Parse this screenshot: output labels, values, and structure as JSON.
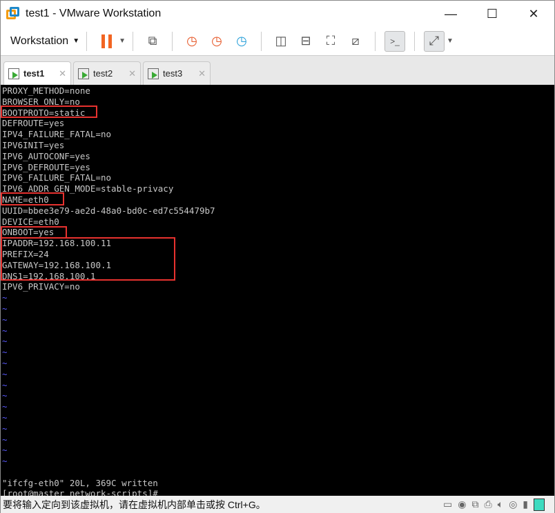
{
  "window": {
    "title": "test1 - VMware Workstation",
    "minimize": "—",
    "maximize": "☐",
    "close": "✕"
  },
  "toolbar": {
    "menu_label": "Workstation",
    "icons": [
      "pause-icon",
      "send-ctrl-alt-del-icon",
      "snapshot-take-icon",
      "snapshot-revert-icon",
      "snapshot-manager-icon",
      "library-view-icon",
      "thumbnail-view-icon",
      "fullscreen-icon",
      "unity-icon",
      "console-view-icon",
      "stretch-icon"
    ]
  },
  "tabs": [
    {
      "label": "test1",
      "active": true
    },
    {
      "label": "test2"
    },
    {
      "label": "test3"
    }
  ],
  "terminal": {
    "lines": [
      "PROXY_METHOD=none",
      "BROWSER_ONLY=no",
      "BOOTPROTO=static",
      "DEFROUTE=yes",
      "IPV4_FAILURE_FATAL=no",
      "IPV6INIT=yes",
      "IPV6_AUTOCONF=yes",
      "IPV6_DEFROUTE=yes",
      "IPV6_FAILURE_FATAL=no",
      "IPV6_ADDR_GEN_MODE=stable-privacy",
      "NAME=eth0",
      "UUID=bbee3e79-ae2d-48a0-bd0c-ed7c554479b7",
      "DEVICE=eth0",
      "ONBOOT=yes",
      "IPADDR=192.168.100.11",
      "PREFIX=24",
      "GATEWAY=192.168.100.1",
      "DNS1=192.168.100.1",
      "IPV6_PRIVACY=no"
    ],
    "tilde": "~",
    "message": "\"ifcfg-eth0\" 20L, 369C written",
    "prompt": "[root@master network-scripts]# _",
    "highlight_color": "#e8322f"
  },
  "statusbar": {
    "hint": "要将输入定向到该虚拟机，请在虚拟机内部单击或按 Ctrl+G。"
  }
}
